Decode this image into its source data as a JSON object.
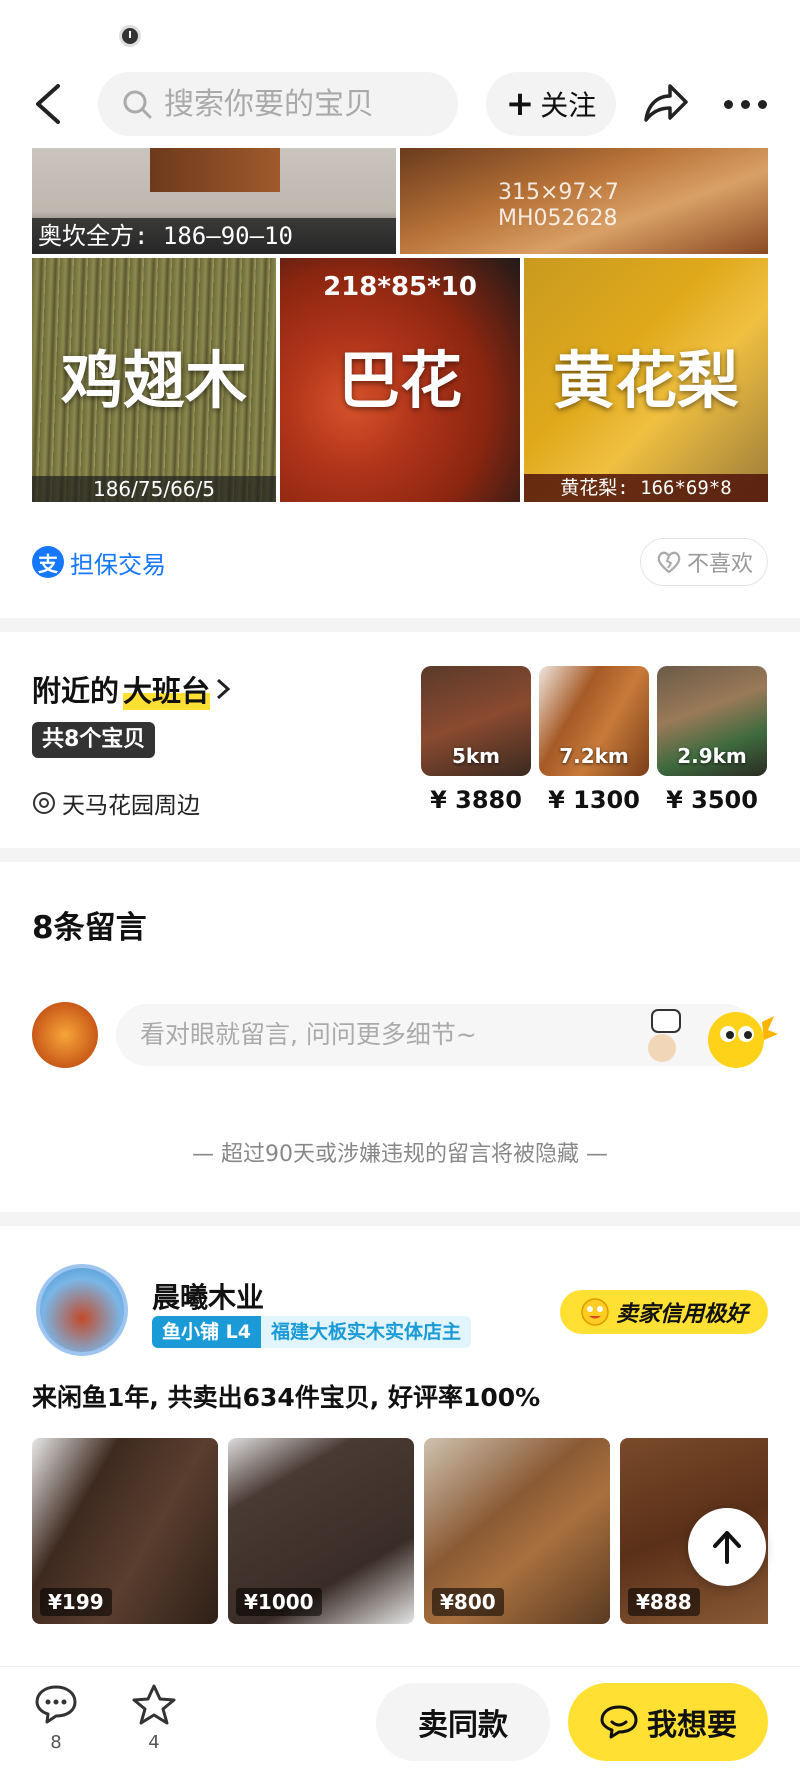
{
  "header": {
    "search_placeholder": "搜索你要的宝贝",
    "follow_label": "关注"
  },
  "collage": {
    "top_left_caption": "奥坎全方: 186—90—10",
    "top_right_caption_1": "315×97×7",
    "top_right_caption_2": "MH052628",
    "tiles": [
      {
        "name": "鸡翅木",
        "dims": "186/75/66/5"
      },
      {
        "name": "巴花",
        "dims": "218*85*10"
      },
      {
        "name": "黄花梨",
        "dims": "黄花梨: 166*69*8"
      }
    ]
  },
  "guarantee": {
    "label": "担保交易",
    "dislike_label": "不喜欢"
  },
  "nearby": {
    "title_prefix": "附近的",
    "title_highlight": "大班台",
    "count": "共8个宝贝",
    "location": "天马花园周边",
    "items": [
      {
        "distance": "5km",
        "price": "¥ 3880"
      },
      {
        "distance": "7.2km",
        "price": "¥ 1300"
      },
      {
        "distance": "2.9km",
        "price": "¥ 3500"
      }
    ]
  },
  "comments": {
    "title": "8条留言",
    "input_placeholder": "看对眼就留言, 问问更多细节~",
    "hidden_note": "— 超过90天或涉嫌违规的留言将被隐藏 —"
  },
  "seller": {
    "name": "晨曦木业",
    "shop_level": "鱼小铺 L4",
    "shop_desc": "福建大板实木实体店主",
    "credit": "卖家信用极好",
    "stats": "来闲鱼1年, 共卖出634件宝贝, 好评率100%",
    "listings": [
      {
        "price": "¥199"
      },
      {
        "price": "¥1000"
      },
      {
        "price": "¥800"
      },
      {
        "price": "¥888"
      }
    ]
  },
  "bottom_bar": {
    "comment_count": "8",
    "favorite_count": "4",
    "sell_same_label": "卖同款",
    "want_label": "我想要"
  },
  "colors": {
    "accent_yellow": "#ffe033",
    "alipay_blue": "#1677ff",
    "shop_blue": "#1a9bd7"
  }
}
